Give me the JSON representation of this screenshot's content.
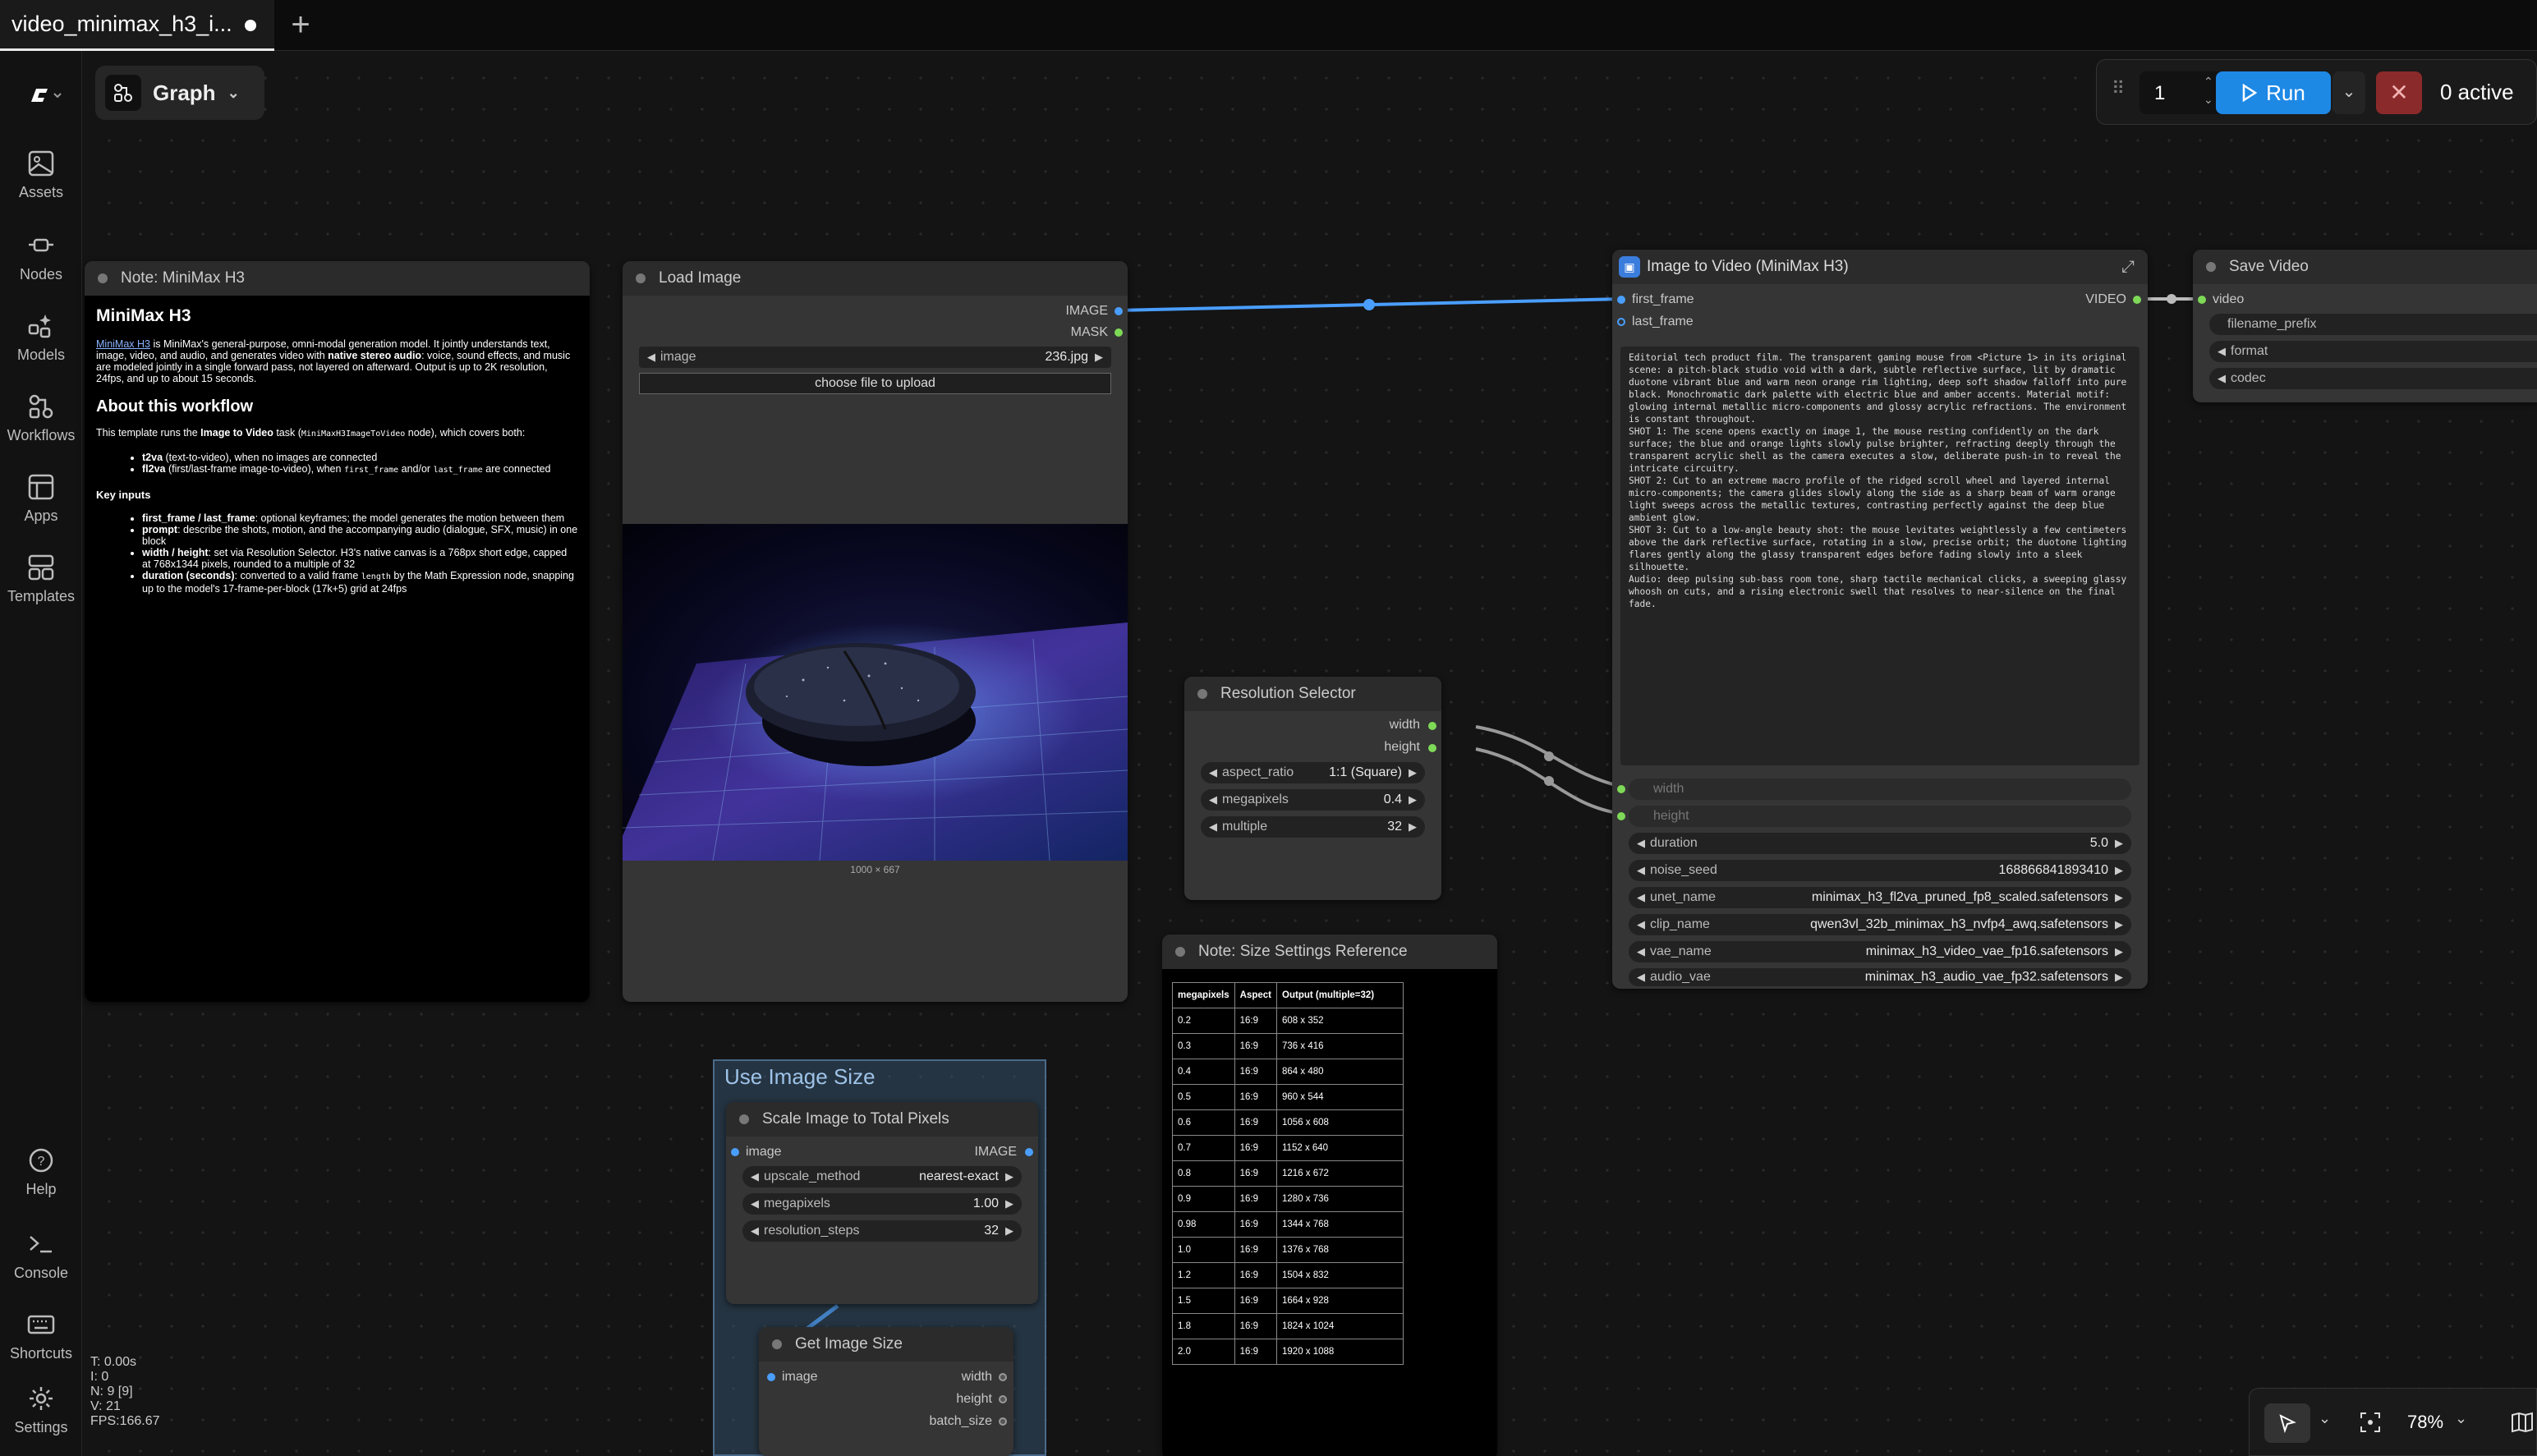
{
  "tab": {
    "title": "video_minimax_h3_i..."
  },
  "sidebar": {
    "items": [
      {
        "label": "Assets"
      },
      {
        "label": "Nodes"
      },
      {
        "label": "Models"
      },
      {
        "label": "Workflows"
      },
      {
        "label": "Apps"
      },
      {
        "label": "Templates"
      },
      {
        "label": "Help"
      },
      {
        "label": "Console"
      },
      {
        "label": "Shortcuts"
      },
      {
        "label": "Settings"
      }
    ]
  },
  "view": {
    "label": "Graph"
  },
  "run": {
    "count": "1",
    "label": "Run",
    "active": "0 active"
  },
  "stats": {
    "t": "T: 0.00s",
    "i": "I: 0",
    "n": "N: 9 [9]",
    "v": "V: 21",
    "fps": "FPS:166.67"
  },
  "zoom": {
    "level": "78%"
  },
  "note_minimax": {
    "title": "Note: MiniMax H3",
    "heading": "MiniMax H3",
    "intro_link": "MiniMax H3",
    "intro_a": " is MiniMax's general-purpose, omni-modal generation model. It jointly understands text, image, video, and audio, and generates video with ",
    "intro_bold": "native stereo audio",
    "intro_b": ": voice, sound effects, and music are modeled jointly in a single forward pass, not layered on afterward. Output is up to 2K resolution, 24fps, and up to about 15 seconds.",
    "about_heading": "About this workflow",
    "about_a": "This template runs the ",
    "about_bold": "Image to Video",
    "about_b": " task (",
    "about_code": "MiniMaxH3ImageToVideo",
    "about_c": " node), which covers both:",
    "mode1_bold": "t2va",
    "mode1": " (text-to-video), when no images are connected",
    "mode2_bold": "fl2va",
    "mode2_a": " (first/last-frame image-to-video), when ",
    "mode2_code1": "first_frame",
    "mode2_b": " and/or ",
    "mode2_code2": "last_frame",
    "mode2_c": " are connected",
    "inputs_heading": "Key inputs",
    "in1_bold": "first_frame / last_frame",
    "in1": ": optional keyframes; the model generates the motion between them",
    "in2_bold": "prompt",
    "in2": ": describe the shots, motion, and the accompanying audio (dialogue, SFX, music) in one block",
    "in3_bold": "width / height",
    "in3": ": set via Resolution Selector. H3's native canvas is a 768px short edge, capped at 768x1344 pixels, rounded to a multiple of 32",
    "in4_bold": "duration (seconds)",
    "in4_a": ": converted to a valid frame ",
    "in4_code": "length",
    "in4_b": " by the Math Expression node, snapping up to the model's 17-frame-per-block (17k+5) grid at 24fps"
  },
  "load_image": {
    "title": "Load Image",
    "out_image": "IMAGE",
    "out_mask": "MASK",
    "widget_label": "image",
    "widget_value": "236.jpg",
    "upload": "choose file to upload",
    "dims": "1000 × 667"
  },
  "resolution": {
    "title": "Resolution Selector",
    "out_width": "width",
    "out_height": "height",
    "widgets": [
      {
        "label": "aspect_ratio",
        "value": "1:1 (Square)"
      },
      {
        "label": "megapixels",
        "value": "0.4"
      },
      {
        "label": "multiple",
        "value": "32"
      }
    ]
  },
  "i2v": {
    "title": "Image to Video (MiniMax H3)",
    "in_first": "first_frame",
    "in_last": "last_frame",
    "out_video": "VIDEO",
    "prompt": "Editorial tech product film. The transparent gaming mouse from <Picture 1> in its original scene: a pitch-black studio void with a dark, subtle reflective surface, lit by dramatic duotone vibrant blue and warm neon orange rim lighting, deep soft shadow falloff into pure black. Monochromatic dark palette with electric blue and amber accents. Material motif: glowing internal metallic micro-components and glossy acrylic refractions. The environment is constant throughout.\nSHOT 1: The scene opens exactly on image 1, the mouse resting confidently on the dark surface; the blue and orange lights slowly pulse brighter, refracting deeply through the transparent acrylic shell as the camera executes a slow, deliberate push-in to reveal the intricate circuitry.\nSHOT 2: Cut to an extreme macro profile of the ridged scroll wheel and layered internal micro-components; the camera glides slowly along the side as a sharp beam of warm orange light sweeps across the metallic textures, contrasting perfectly against the deep blue ambient glow.\nSHOT 3: Cut to a low-angle beauty shot: the mouse levitates weightlessly a few centimeters above the dark reflective surface, rotating in a slow, precise orbit; the duotone lighting flares gently along the glassy transparent edges before fading slowly into a sleek silhouette.\nAudio: deep pulsing sub-bass room tone, sharp tactile mechanical clicks, a sweeping glassy whoosh on cuts, and a rising electronic swell that resolves to near-silence on the final fade.",
    "in_width": "width",
    "in_height": "height",
    "widgets": [
      {
        "label": "duration",
        "value": "5.0"
      },
      {
        "label": "noise_seed",
        "value": "168866841893410"
      },
      {
        "label": "unet_name",
        "value": "minimax_h3_fl2va_pruned_fp8_scaled.safetensors"
      },
      {
        "label": "clip_name",
        "value": "qwen3vl_32b_minimax_h3_nvfp4_awq.safetensors"
      },
      {
        "label": "vae_name",
        "value": "minimax_h3_video_vae_fp16.safetensors"
      },
      {
        "label": "audio_vae",
        "value": "minimax_h3_audio_vae_fp32.safetensors"
      }
    ]
  },
  "save_video": {
    "title": "Save Video",
    "in_video": "video",
    "widgets": [
      {
        "label": "filename_prefix"
      },
      {
        "label": "format"
      },
      {
        "label": "codec"
      }
    ]
  },
  "note_size": {
    "title": "Note: Size Settings Reference",
    "headers": [
      "megapixels",
      "Aspect",
      "Output (multiple=32)"
    ],
    "rows": [
      [
        "0.2",
        "16:9",
        "608 x 352"
      ],
      [
        "0.3",
        "16:9",
        "736 x 416"
      ],
      [
        "0.4",
        "16:9",
        "864 x 480"
      ],
      [
        "0.5",
        "16:9",
        "960 x 544"
      ],
      [
        "0.6",
        "16:9",
        "1056 x 608"
      ],
      [
        "0.7",
        "16:9",
        "1152 x 640"
      ],
      [
        "0.8",
        "16:9",
        "1216 x 672"
      ],
      [
        "0.9",
        "16:9",
        "1280 x 736"
      ],
      [
        "0.98",
        "16:9",
        "1344 x 768"
      ],
      [
        "1.0",
        "16:9",
        "1376 x 768"
      ],
      [
        "1.2",
        "16:9",
        "1504 x 832"
      ],
      [
        "1.5",
        "16:9",
        "1664 x 928"
      ],
      [
        "1.8",
        "16:9",
        "1824 x 1024"
      ],
      [
        "2.0",
        "16:9",
        "1920 x 1088"
      ]
    ]
  },
  "group": {
    "title": "Use Image Size"
  },
  "scale": {
    "title": "Scale Image to Total Pixels",
    "in_image": "image",
    "out_image": "IMAGE",
    "widgets": [
      {
        "label": "upscale_method",
        "value": "nearest-exact"
      },
      {
        "label": "megapixels",
        "value": "1.00"
      },
      {
        "label": "resolution_steps",
        "value": "32"
      }
    ]
  },
  "get_size": {
    "title": "Get Image Size",
    "in_image": "image",
    "out_width": "width",
    "out_height": "height",
    "out_batch": "batch_size"
  },
  "colors": {
    "accent": "#1e88e5",
    "link_blue": "#4a9eff",
    "socket_green": "#7ed957",
    "cancel": "#8b2a2a",
    "group": "#3a5a7a"
  }
}
